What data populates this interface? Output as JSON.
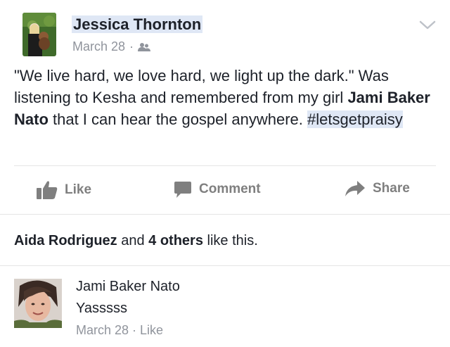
{
  "post": {
    "author": "Jessica Thornton",
    "date": "March 28",
    "separator": "·",
    "audience_icon": "friends-icon",
    "text_part1": "\"We live hard, we love hard, we light up the dark.\" Was listening to Kesha and remembered from my girl ",
    "mention": "Jami Baker Nato",
    "text_part2": " that I can hear the gospel anywhere. ",
    "hashtag": "#letsgetpraisy"
  },
  "actions": {
    "like_label": "Like",
    "comment_label": "Comment",
    "share_label": "Share"
  },
  "likes": {
    "first_name": "Aida Rodriguez",
    "and": " and ",
    "others": "4 others",
    "suffix": " like this."
  },
  "comment": {
    "author": "Jami Baker Nato",
    "text": "Yasssss",
    "date": "March 28",
    "separator": " · ",
    "like_label": "Like"
  },
  "colors": {
    "text": "#1d2129",
    "secondary": "#90949c",
    "action": "#7f7f7f",
    "highlight": "#dfe7f5"
  }
}
